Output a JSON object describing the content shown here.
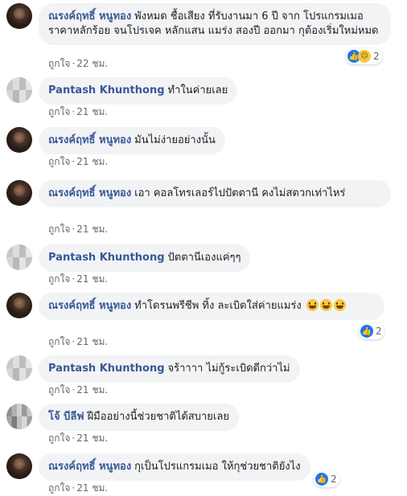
{
  "comments": [
    {
      "author": "ณรงค์ฤทธิ์ หนูทอง",
      "text": "พังหมด ชื้อเสียง ที่รับงานมา 6 ปี จาก โปรแกรมเมอ ราคาหลักร้อย จนโปรเจค หลักแสน แมร่ง สองปี ออกมา กุต้องเริ่มใหม่หมด",
      "like": "ถูกใจ",
      "time": "22 ชม.",
      "reaction_count": "2"
    },
    {
      "author": "Pantash Khunthong",
      "text": "ทำในค่ายเลย",
      "like": "ถูกใจ",
      "time": "21 ชม."
    },
    {
      "author": "ณรงค์ฤทธิ์ หนูทอง",
      "text": "มันไม่ง่ายอย่างนั้น",
      "like": "ถูกใจ",
      "time": "21 ชม."
    },
    {
      "author": "ณรงค์ฤทธิ์ หนูทอง",
      "text": "เอา คอลโทรเลอร์ไปปัตตานี คงไม่สตวกเท่าไหร่",
      "like": "ถูกใจ",
      "time": "21 ชม."
    },
    {
      "author": "Pantash Khunthong",
      "text": "ปัตตานีเองแค่ๆๆ",
      "like": "ถูกใจ",
      "time": "21 ชม."
    },
    {
      "author": "ณรงค์ฤทธิ์ หนูทอง",
      "text": "ทำโดรนพรีชีพ ทิ้ง ละเบิดใส่ค่ายแมร่ง",
      "like": "ถูกใจ",
      "time": "21 ชม.",
      "reaction_count": "2"
    },
    {
      "author": "Pantash Khunthong",
      "text": "จร้าาาา ไม่กู้ระเบิดดีกว่าไม่",
      "like": "ถูกใจ",
      "time": "21 ชม."
    },
    {
      "author": "โจ้ บีลีฟ",
      "text": "ฝีมืออย่างนี้ช่วยชาติได้สบายเลย",
      "like": "ถูกใจ",
      "time": "21 ชม."
    },
    {
      "author": "ณรงค์ฤทธิ์ หนูทอง",
      "text": "กุเป็นโปรแกรมเมอ ให้กุช่วยชาติยังไง",
      "like": "ถูกใจ",
      "time": "21 ชม.",
      "reaction_count": "2"
    }
  ],
  "separator": "·",
  "icons": {
    "like_reaction": "thumbs-up-icon",
    "sad_reaction": "sad-face-icon",
    "emoji": "grinning-face-icon"
  },
  "colors": {
    "author": "#385898",
    "bubble": "#f2f3f5",
    "meta": "#606770",
    "like_blue": "#1877f2"
  }
}
